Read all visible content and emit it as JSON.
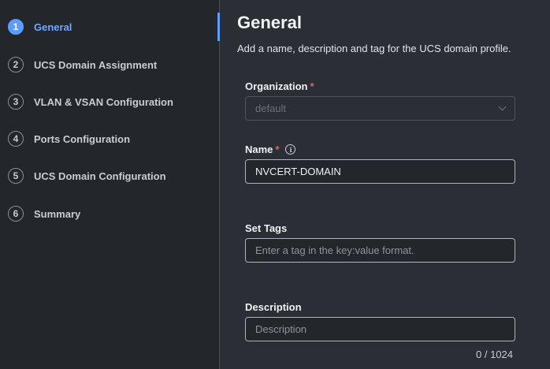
{
  "wizard": {
    "steps": [
      {
        "num": "1",
        "label": "General"
      },
      {
        "num": "2",
        "label": "UCS Domain Assignment"
      },
      {
        "num": "3",
        "label": "VLAN & VSAN Configuration"
      },
      {
        "num": "4",
        "label": "Ports Configuration"
      },
      {
        "num": "5",
        "label": "UCS Domain Configuration"
      },
      {
        "num": "6",
        "label": "Summary"
      }
    ],
    "active_step": "General"
  },
  "main": {
    "title": "General",
    "subtitle": "Add a name, description and tag for the UCS domain profile."
  },
  "form": {
    "organization": {
      "label": "Organization",
      "required_mark": "*",
      "value": "default"
    },
    "name": {
      "label": "Name",
      "required_mark": "*",
      "value": "NVCERT-DOMAIN",
      "info_icon": "info-icon"
    },
    "tags": {
      "label": "Set Tags",
      "placeholder": "Enter a tag in the key:value format."
    },
    "description": {
      "label": "Description",
      "placeholder": "Description",
      "counter": "0 / 1024"
    }
  },
  "colors": {
    "accent": "#5e9bff",
    "required": "#e2665a",
    "background": "#2b2f35",
    "sidebar": "#23272c"
  }
}
